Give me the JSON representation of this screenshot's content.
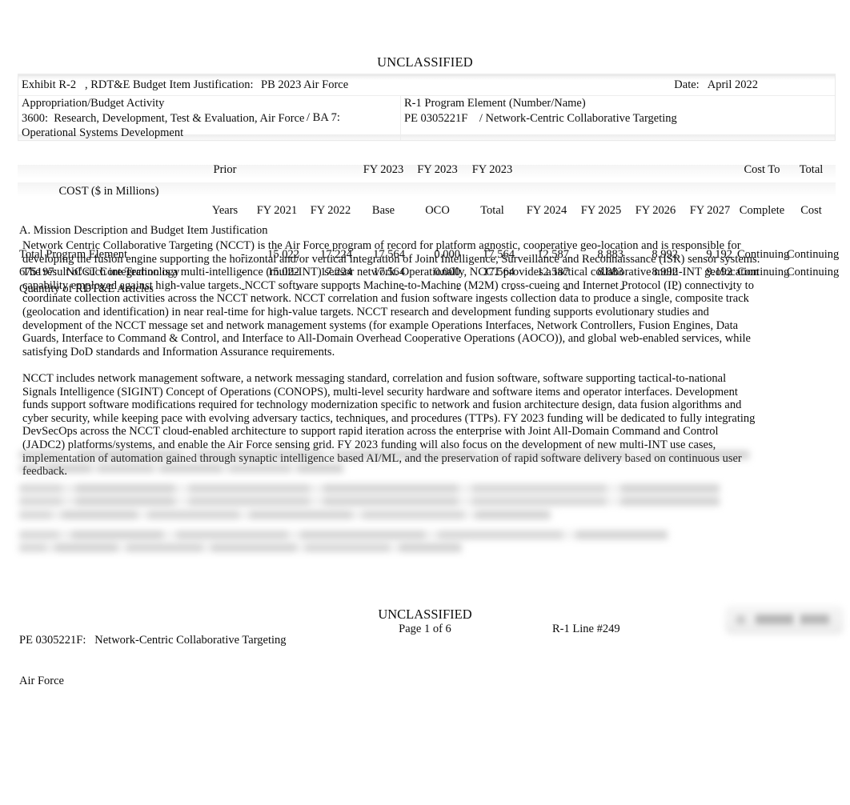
{
  "document": {
    "classification_top": "UNCLASSIFIED",
    "classification_bottom": "UNCLASSIFIED"
  },
  "header": {
    "exhibit_label": "Exhibit R-2   , RDT&E Budget Item Justification:",
    "exhibit_budget": "PB 2023 Air Force",
    "date_label": "Date:   April 2022",
    "appropriation_title": "Appropriation/Budget Activity",
    "appropriation_value": "3600:  Research, Development, Test & Evaluation, Air Force",
    "budget_activity": "/ BA 7:",
    "appropriation_value2": "Operational Systems Development",
    "program_element_title": "R-1 Program Element (Number/Name)",
    "program_element_value": "PE 0305221F    / Network-Centric Collaborative Targeting"
  },
  "cost_table": {
    "row_label_header": "COST ($ in Millions)",
    "columns": [
      {
        "line1": "Prior",
        "line2": "Years"
      },
      {
        "line1": "",
        "line2": "FY 2021"
      },
      {
        "line1": "",
        "line2": "FY 2022"
      },
      {
        "line1": "FY 2023",
        "line2": "Base"
      },
      {
        "line1": "FY 2023",
        "line2": "OCO"
      },
      {
        "line1": "FY 2023",
        "line2": "Total"
      },
      {
        "line1": "",
        "line2": "FY 2024"
      },
      {
        "line1": "",
        "line2": "FY 2025"
      },
      {
        "line1": "",
        "line2": "FY 2026"
      },
      {
        "line1": "",
        "line2": "FY 2027"
      },
      {
        "line1": "Cost To",
        "line2": "Complete"
      },
      {
        "line1": "Total",
        "line2": "Cost"
      }
    ],
    "rows": [
      {
        "name": "Total Program Element",
        "values": [
          "-",
          "15.022",
          "17.224",
          "17.564",
          "0.000",
          "17.564",
          "12.587",
          "8.883",
          "8.992",
          "9.192",
          "Continuing",
          "Continuing"
        ]
      },
      {
        "name": "675197:   NCCT Core Technology",
        "values": [
          "-",
          "15.022",
          "17.224",
          "17.564",
          "0.000",
          "17.564",
          "12.587",
          "8.883",
          "8.992",
          "9.192",
          "Continuing",
          "Continuing"
        ]
      },
      {
        "name": "Quantity of RDT&E Articles",
        "values": [
          "-",
          "-",
          "-",
          "-",
          "-",
          "-",
          "-",
          "-",
          "-",
          "-",
          "",
          ""
        ]
      }
    ]
  },
  "section_a": {
    "heading": "A. Mission Description and Budget Item Justification",
    "paragraphs": [
      "Network Centric Collaborative Targeting (NCCT) is the Air Force program of record for platform agnostic, cooperative geo-location and is responsible for developing the fusion engine supporting the horizontal and/or vertical integration of Joint Intelligence, Surveillance and Reconnaissance (ISR) sensor systems. The result of such integration is a multi-intelligence (multi-INT) sensor network. Operationally, NCCT provides a tactical collaborative multi-INT geolocation capability employed against high-value targets. NCCT software supports Machine-to-Machine (M2M) cross-cueing and Internet Protocol (IP) connectivity to coordinate collection activities across the NCCT network. NCCT correlation and fusion software ingests collection data to produce a single, composite track (geolocation and identification) in near real-time for high-value targets. NCCT research and development funding supports evolutionary studies and development of the NCCT message set and network management systems (for example Operations Interfaces, Network Controllers, Fusion Engines, Data Guards, Interface to Command & Control, and Interface to All-Domain Overhead Cooperative Operations (AOCO)), and global web-enabled services, while satisfying DoD standards and Information Assurance requirements.",
      "NCCT includes network management software, a network messaging standard, correlation and fusion software, software supporting tactical-to-national Signals Intelligence (SIGINT) Concept of Operations (CONOPS), multi-level security hardware and software items and operator interfaces. Development funds support software modifications required for technology modernization specific to network and fusion architecture design, data fusion algorithms and cyber security, while keeping pace with evolving adversary tactics, techniques, and procedures (TTPs). FY 2023 funding will be dedicated to fully integrating DevSecOps across the NCCT cloud-enabled architecture to support rapid iteration across the enterprise with Joint All-Domain Command and Control (JADC2) platforms/systems, and enable the Air Force sensing grid. FY 2023 funding will also focus on the development of new multi-INT use cases, implementation of automation gained through synaptic intelligence based AI/ML, and the preservation of rapid software delivery based on continuous user feedback."
    ]
  },
  "footer": {
    "program_element": "PE 0305221F:   Network-Centric Collaborative Targeting",
    "service": "Air Force",
    "page": "Page 1 of 6",
    "r1_line": "R-1 Line #249"
  }
}
